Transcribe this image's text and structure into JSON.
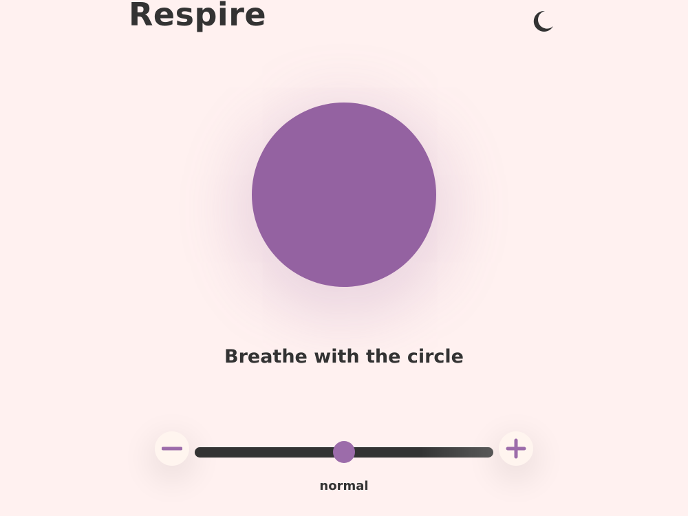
{
  "app": {
    "title": "Respire"
  },
  "header": {
    "theme_toggle_icon": "moon-icon"
  },
  "breathing": {
    "circle_color": "#9462a1",
    "instruction": "Breathe with the circle"
  },
  "speed_control": {
    "decrease_icon": "minus-icon",
    "increase_icon": "plus-icon",
    "level": 0.5,
    "label": "normal",
    "accent_color": "#9c6caa"
  },
  "colors": {
    "background": "#fff1f0",
    "text": "#333333",
    "track": "#333333"
  }
}
